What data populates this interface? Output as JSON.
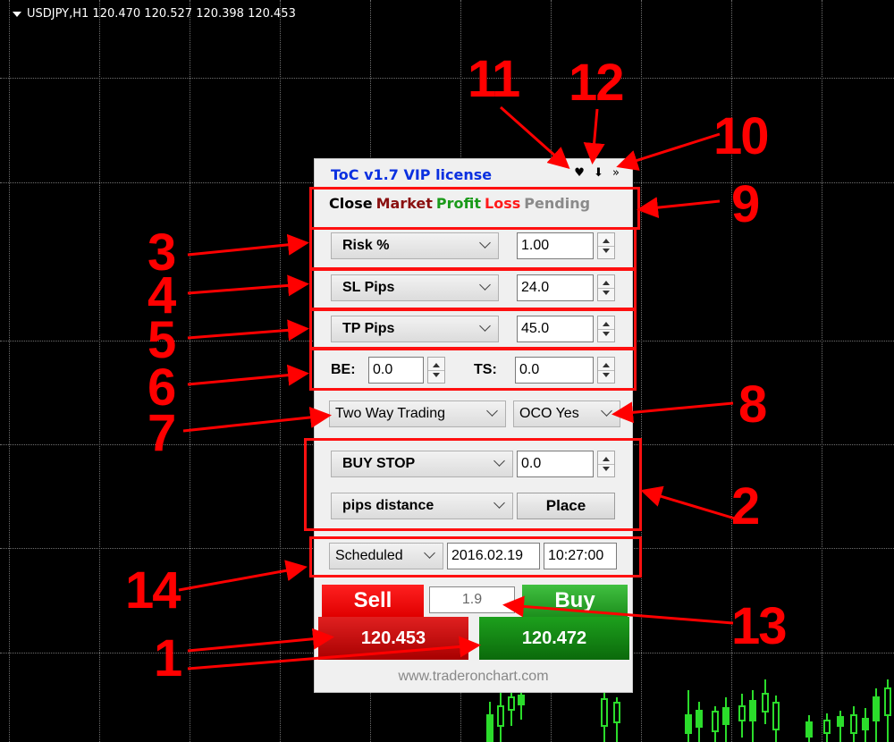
{
  "chart": {
    "header": "USDJPY,H1  120.470 120.527 120.398 120.453"
  },
  "panel": {
    "title": "ToC v1.7 VIP license",
    "title_icons": [
      "♥",
      "⬇",
      "»"
    ],
    "tabs": [
      {
        "label": "Close",
        "color": "#000000"
      },
      {
        "label": "Market",
        "color": "#8a1010"
      },
      {
        "label": "Profit",
        "color": "#1a9a1a"
      },
      {
        "label": "Loss",
        "color": "#ff1a1a"
      },
      {
        "label": "Pending",
        "color": "#8a8a8a"
      }
    ],
    "risk": {
      "label": "Risk %",
      "value": "1.00"
    },
    "sl": {
      "label": "SL Pips",
      "value": "24.0"
    },
    "tp": {
      "label": "TP Pips",
      "value": "45.0"
    },
    "be": {
      "label": "BE:",
      "value": "0.0"
    },
    "ts": {
      "label": "TS:",
      "value": "0.0"
    },
    "trading_mode": "Two Way Trading",
    "oco": "OCO Yes",
    "pending_type": "BUY STOP",
    "pending_value": "0.0",
    "distance_mode": "pips distance",
    "place_label": "Place",
    "schedule": {
      "mode": "Scheduled",
      "date": "2016.02.19",
      "time": "10:27:00"
    },
    "sell": {
      "label": "Sell",
      "price": "120.453"
    },
    "buy": {
      "label": "Buy",
      "price": "120.472"
    },
    "spread": "1.9",
    "footer": "www.traderonchart.com"
  },
  "annotations": [
    "1",
    "2",
    "3",
    "4",
    "5",
    "6",
    "7",
    "8",
    "9",
    "10",
    "11",
    "12",
    "13",
    "14"
  ]
}
